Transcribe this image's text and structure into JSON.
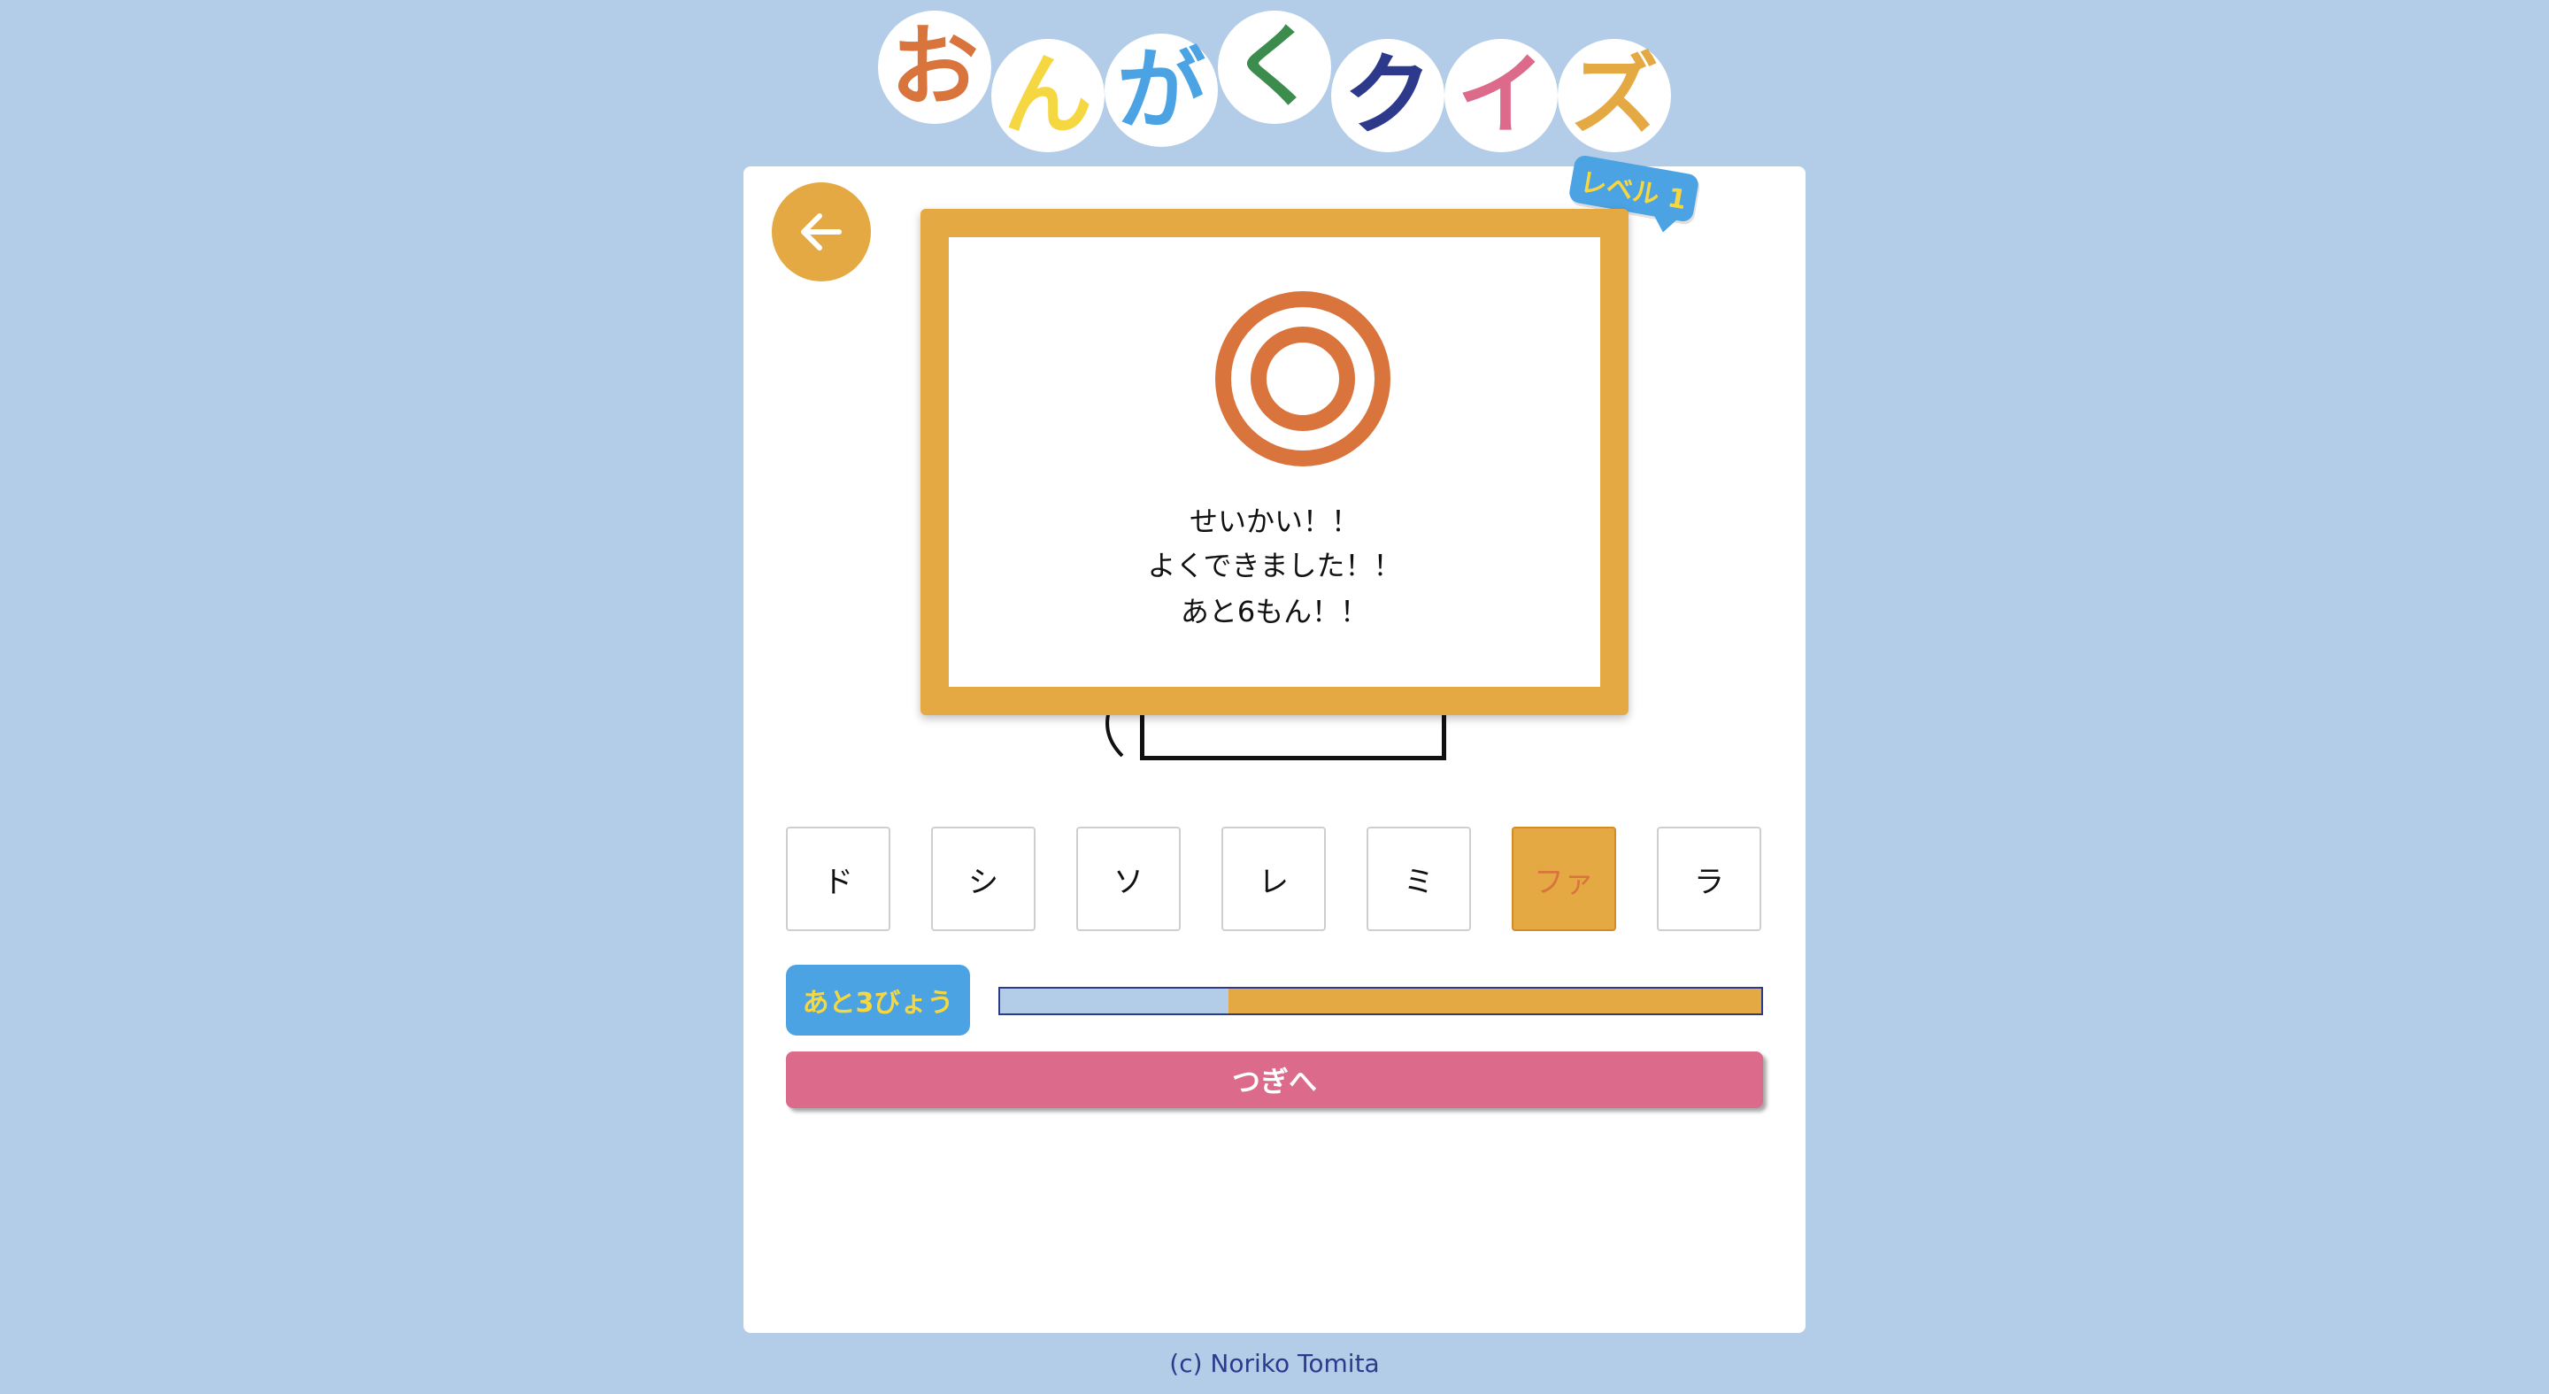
{
  "title": {
    "chars": [
      {
        "char": "お",
        "color": "#d9743d"
      },
      {
        "char": "ん",
        "color": "#f5d742"
      },
      {
        "char": "が",
        "color": "#4ba3e3"
      },
      {
        "char": "く",
        "color": "#3c8c4e"
      },
      {
        "char": "ク",
        "color": "#2d3a8c"
      },
      {
        "char": "イ",
        "color": "#db6a8b"
      },
      {
        "char": "ズ",
        "color": "#e5a944"
      }
    ]
  },
  "level_badge": "レベル 1",
  "back_button": {
    "icon": "arrow-left-icon"
  },
  "result_modal": {
    "icon": "double-circle-icon",
    "line1": "せいかい！！",
    "line2": "よくできました！！",
    "line3": "あと6もん！！"
  },
  "notes": [
    {
      "label": "ド",
      "selected": false
    },
    {
      "label": "シ",
      "selected": false
    },
    {
      "label": "ソ",
      "selected": false
    },
    {
      "label": "レ",
      "selected": false
    },
    {
      "label": "ミ",
      "selected": false
    },
    {
      "label": "ファ",
      "selected": true
    },
    {
      "label": "ラ",
      "selected": false
    }
  ],
  "timer": {
    "label": "あと3びょう",
    "remaining_fraction": 0.7
  },
  "next_button": "つぎへ",
  "footer": "(c) Noriko Tomita",
  "colors": {
    "background": "#b3cde8",
    "accent_orange": "#e5a944",
    "accent_blue": "#4ba3e3",
    "accent_pink": "#db6a8b",
    "mark_red": "#d9743d"
  }
}
